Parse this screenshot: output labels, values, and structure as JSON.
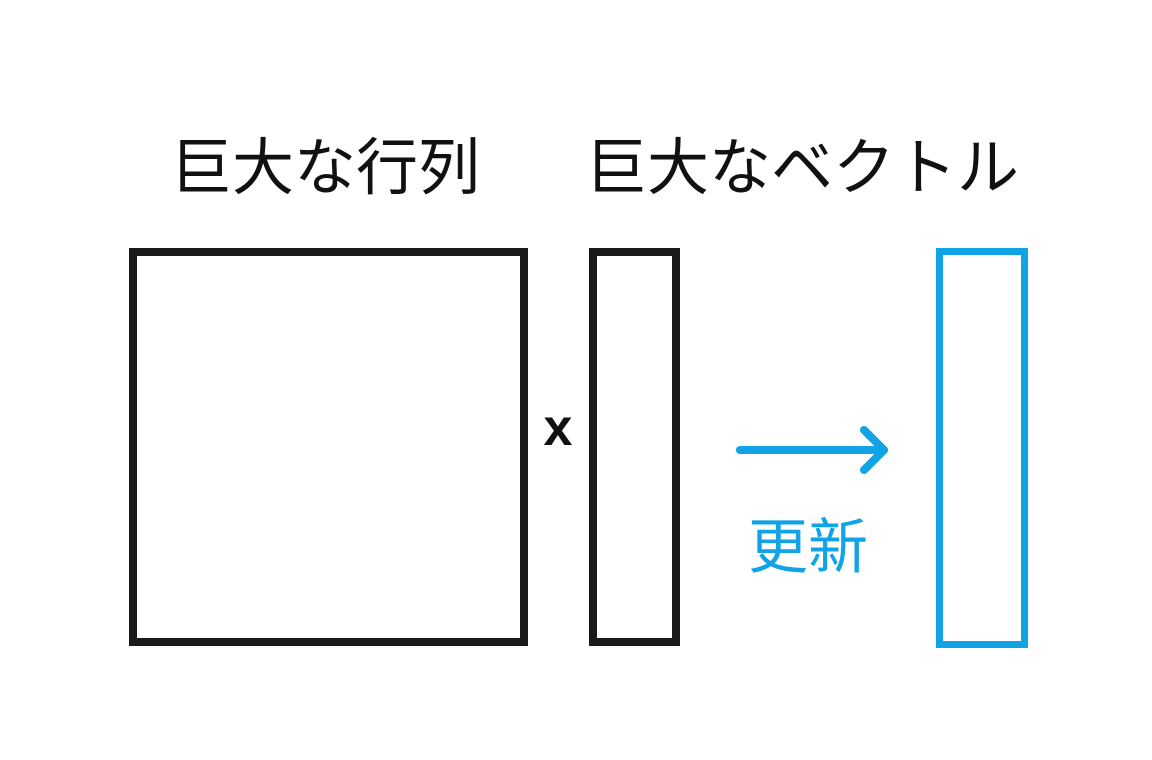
{
  "labels": {
    "matrix": "巨大な行列",
    "vector": "巨大なベクトル",
    "operator": "x",
    "update": "更新"
  },
  "icons": {
    "arrow": "arrow-right-icon"
  },
  "colors": {
    "outline": "#1a1a1a",
    "accent": "#12a3e6",
    "text": "#111111"
  }
}
